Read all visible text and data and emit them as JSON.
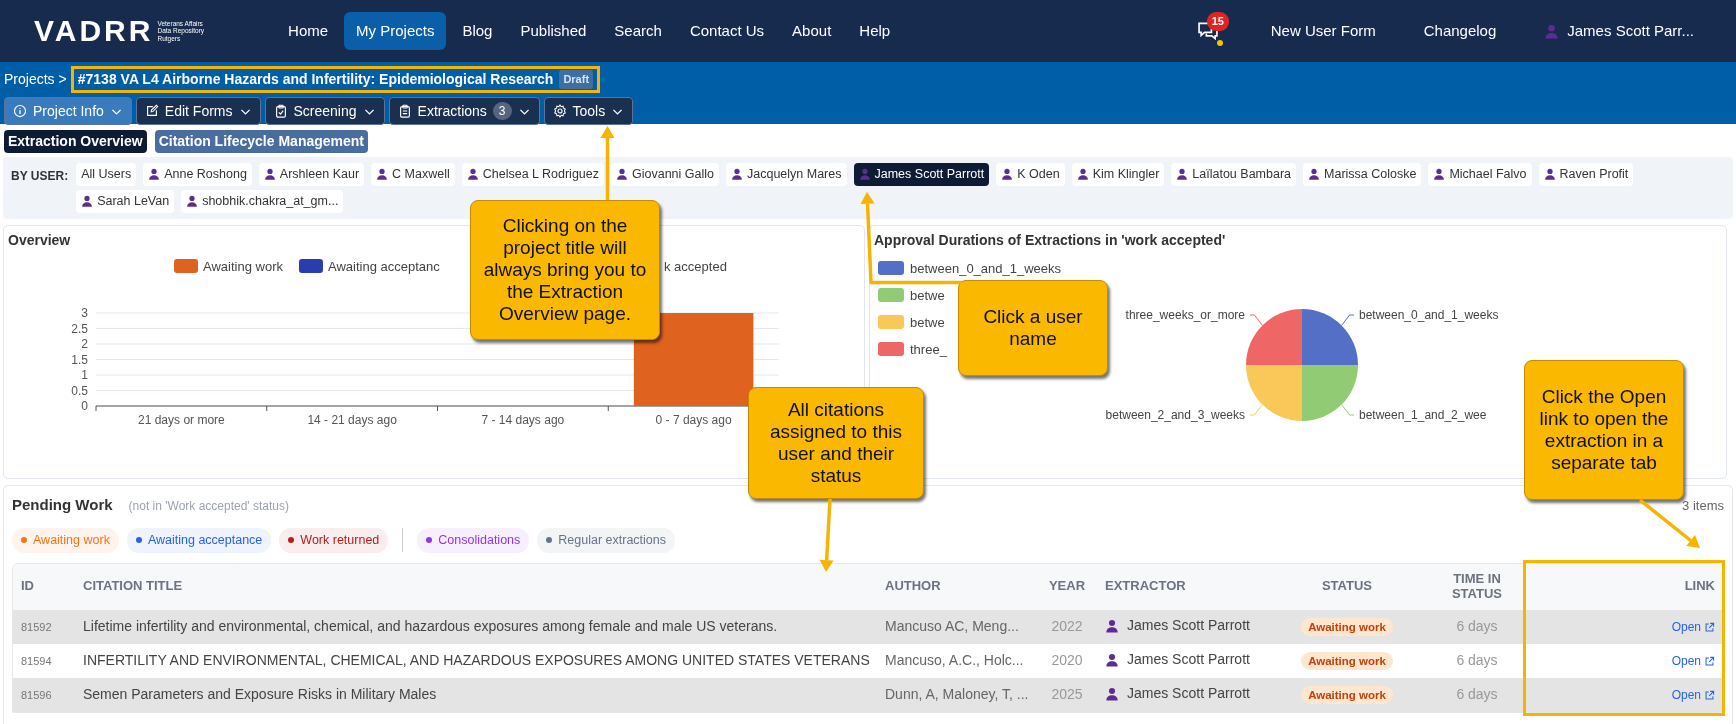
{
  "navbar": {
    "logo": "VADRR",
    "logo_subtitle": [
      "Veterans Affairs",
      "Data Repository",
      "Rutgers"
    ],
    "items": [
      {
        "label": "Home",
        "selected": false
      },
      {
        "label": "My Projects",
        "selected": true
      },
      {
        "label": "Blog",
        "selected": false
      },
      {
        "label": "Published",
        "selected": false
      },
      {
        "label": "Search",
        "selected": false
      },
      {
        "label": "Contact Us",
        "selected": false
      },
      {
        "label": "About",
        "selected": false
      },
      {
        "label": "Help",
        "selected": false
      }
    ],
    "notifications": "15",
    "right_links": [
      "New User Form",
      "Changelog"
    ],
    "user": "James Scott Parr..."
  },
  "breadcrumb": {
    "root": "Projects",
    "separator": ">",
    "project": "#7138 VA L4 Airborne Hazards and Infertility: Epidemiological Research",
    "badge": "Draft"
  },
  "toolbar": [
    {
      "label": "Project Info",
      "selected": true
    },
    {
      "label": "Edit Forms",
      "selected": false
    },
    {
      "label": "Screening",
      "selected": false
    },
    {
      "label": "Extractions",
      "count": "3",
      "selected": false
    },
    {
      "label": "Tools",
      "selected": false
    }
  ],
  "view_tabs": [
    {
      "label": "Extraction Overview",
      "selected": true
    },
    {
      "label": "Citation Lifecycle Management",
      "selected": false
    }
  ],
  "user_filter": {
    "label": "BY USER:",
    "users": [
      {
        "name": "All Users",
        "kind": "all",
        "selected": false
      },
      {
        "name": "Anne Roshong",
        "kind": "user",
        "selected": false
      },
      {
        "name": "Arshleen Kaur",
        "kind": "user",
        "selected": false
      },
      {
        "name": "C Maxwell",
        "kind": "user",
        "selected": false
      },
      {
        "name": "Chelsea L Rodriguez",
        "kind": "user",
        "selected": false
      },
      {
        "name": "Giovanni Gallo",
        "kind": "user",
        "selected": false
      },
      {
        "name": "Jacquelyn Mares",
        "kind": "user",
        "selected": false
      },
      {
        "name": "James Scott Parrott",
        "kind": "user",
        "selected": true
      },
      {
        "name": "K Oden",
        "kind": "user",
        "selected": false
      },
      {
        "name": "Kim Klingler",
        "kind": "user",
        "selected": false
      },
      {
        "name": "Laïlatou Bambara",
        "kind": "user",
        "selected": false
      },
      {
        "name": "Marissa Coloske",
        "kind": "user",
        "selected": false
      },
      {
        "name": "Michael Falvo",
        "kind": "user",
        "selected": false
      },
      {
        "name": "Raven Profit",
        "kind": "user",
        "selected": false
      },
      {
        "name": "Sarah LeVan",
        "kind": "user",
        "selected": false
      },
      {
        "name": "shobhik.chakra_at_gm...",
        "kind": "user",
        "selected": false
      }
    ]
  },
  "overview": {
    "title": "Overview",
    "legend_fragment": "k accepted",
    "chart_data": {
      "type": "bar",
      "categories": [
        "21 days or more",
        "14 - 21 days ago",
        "7 - 14 days ago",
        "0 - 7 days ago"
      ],
      "series": [
        {
          "name": "Awaiting work",
          "color": "#df621e",
          "values": [
            0,
            0,
            0,
            3
          ]
        },
        {
          "name": "Awaiting acceptanc",
          "color": "#2b3dae",
          "values": [
            0,
            0,
            0,
            0
          ]
        }
      ],
      "ylim": [
        0,
        3
      ],
      "yticks": [
        0,
        0.5,
        1,
        1.5,
        2,
        2.5,
        3
      ],
      "grid": true
    }
  },
  "approval": {
    "title": "Approval Durations of Extractions in 'work accepted'",
    "legend": [
      {
        "label": "between_0_and_1_weeks",
        "color": "#5470c6"
      },
      {
        "label": "betwe",
        "color": "#91cc75"
      },
      {
        "label": "betwe",
        "color": "#fac858"
      },
      {
        "label": "three_",
        "color": "#ee6666"
      }
    ],
    "chart_data": {
      "type": "pie",
      "categories": [
        "between_0_and_1_weeks",
        "between_1_and_2_wee",
        "between_2_and_3_weeks",
        "three_weeks_or_more"
      ],
      "values": [
        1,
        1,
        1,
        1
      ]
    }
  },
  "pending": {
    "title": "Pending Work",
    "subtitle": "(not in 'Work accepted' status)",
    "count": "3 items",
    "status_filters": [
      {
        "label": "Awaiting work",
        "color": "#f97316"
      },
      {
        "label": "Awaiting acceptance",
        "color": "#2563eb"
      },
      {
        "label": "Work returned",
        "color": "#b91c1c"
      }
    ],
    "type_filters": [
      {
        "label": "Consolidations",
        "color": "#9333ea"
      },
      {
        "label": "Regular extractions",
        "color": "#64748b"
      }
    ],
    "columns": [
      "ID",
      "CITATION TITLE",
      "AUTHOR",
      "YEAR",
      "EXTRACTOR",
      "STATUS",
      "TIME IN STATUS",
      "LINK"
    ],
    "rows": [
      {
        "id": "81592",
        "title": "Lifetime infertility and environmental, chemical, and hazardous exposures among female and male US veterans.",
        "author": "Mancuso AC, Meng...",
        "year": "2022",
        "extractor": "James Scott Parrott",
        "status": "Awaiting work",
        "time": "6 days",
        "link": "Open"
      },
      {
        "id": "81594",
        "title": "INFERTILITY AND ENVIRONMENTAL, CHEMICAL, AND HAZARDOUS EXPOSURES AMONG UNITED STATES VETERANS",
        "author": "Mancuso, A.C., Holc...",
        "year": "2020",
        "extractor": "James Scott Parrott",
        "status": "Awaiting work",
        "time": "6 days",
        "link": "Open"
      },
      {
        "id": "81596",
        "title": "Semen Parameters and Exposure Risks in Military Males",
        "author": "Dunn, A, Maloney, T, ...",
        "year": "2025",
        "extractor": "James Scott Parrott",
        "status": "Awaiting work",
        "time": "6 days",
        "link": "Open"
      }
    ]
  },
  "annotations": [
    {
      "text": "Clicking on the project title will always bring you to the Extraction Overview page."
    },
    {
      "text": "Click a user name"
    },
    {
      "text": "All citations assigned to this user and their status"
    },
    {
      "text": "Click the Open link to open the extraction in a separate tab"
    }
  ]
}
